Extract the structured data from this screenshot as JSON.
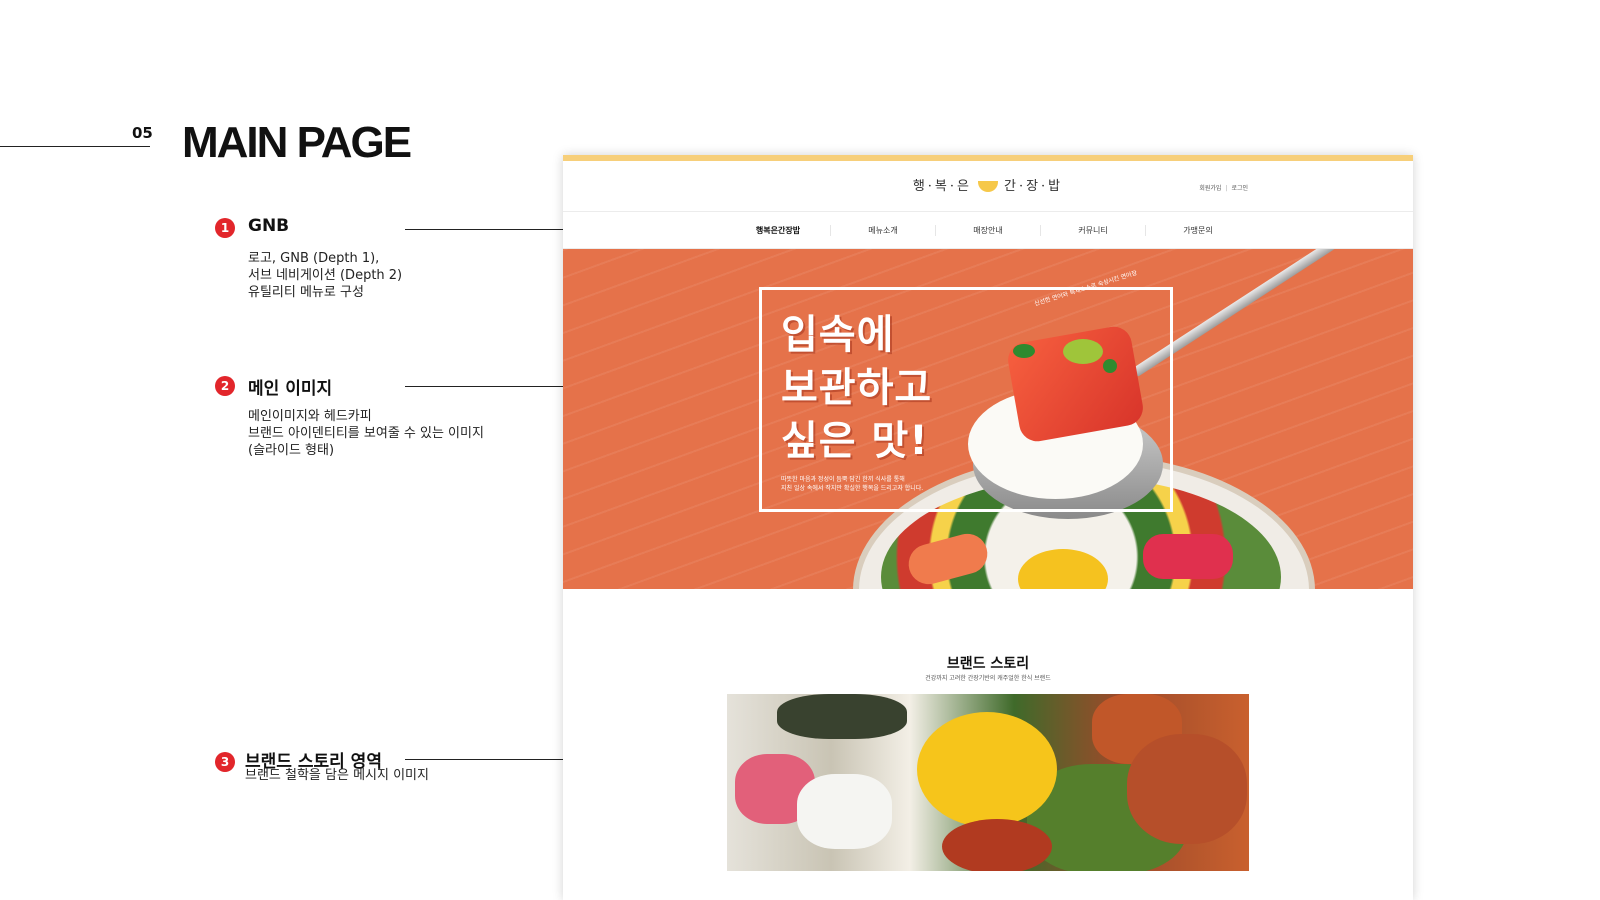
{
  "page": {
    "number": "05",
    "title": "MAIN PAGE"
  },
  "annotations": [
    {
      "index": "1",
      "heading": "GNB",
      "desc": [
        "로고, GNB (Depth 1),",
        "서브 네비게이션 (Depth 2)",
        "유틸리티 메뉴로 구성"
      ]
    },
    {
      "index": "2",
      "heading": "메인 이미지",
      "desc": [
        "메인이미지와 헤드카피",
        "브랜드 아이덴티티를 보여줄 수 있는 이미지",
        "(슬라이드 형태)"
      ]
    },
    {
      "index": "3",
      "heading": "브랜드 스토리 영역",
      "desc": [
        "브랜드 철학을 담은 메시지 이미지"
      ]
    }
  ],
  "colors": {
    "badge": "#e2262b",
    "topbar": "#f7cf7a",
    "hero": "#e5724a"
  },
  "mockup": {
    "logo": {
      "left": "행·복·은",
      "right": "간·장·밥",
      "icon": "bowl-icon"
    },
    "utility": {
      "join": "회원가입",
      "login": "로그인",
      "separator": "|"
    },
    "nav": [
      "행복은간장밥",
      "메뉴소개",
      "매장안내",
      "커뮤니티",
      "가맹문의"
    ],
    "hero": {
      "headline": [
        "입속에",
        "보관하고",
        "싶은 맛!"
      ],
      "sub": [
        "따뜻한 마음과 정성이 듬뿍 담긴 한끼 식사를 통해",
        "지친 일상 속에서 작지만 확실한 행복을 드리고자 합니다."
      ],
      "curved_text": "신선한 연어와 특제소스로 숙성시킨 연어장"
    },
    "story": {
      "title": "브랜드 스토리",
      "subtitle": "건강까지 고려한 간장기반의 캐주얼한 한식 브랜드"
    }
  }
}
